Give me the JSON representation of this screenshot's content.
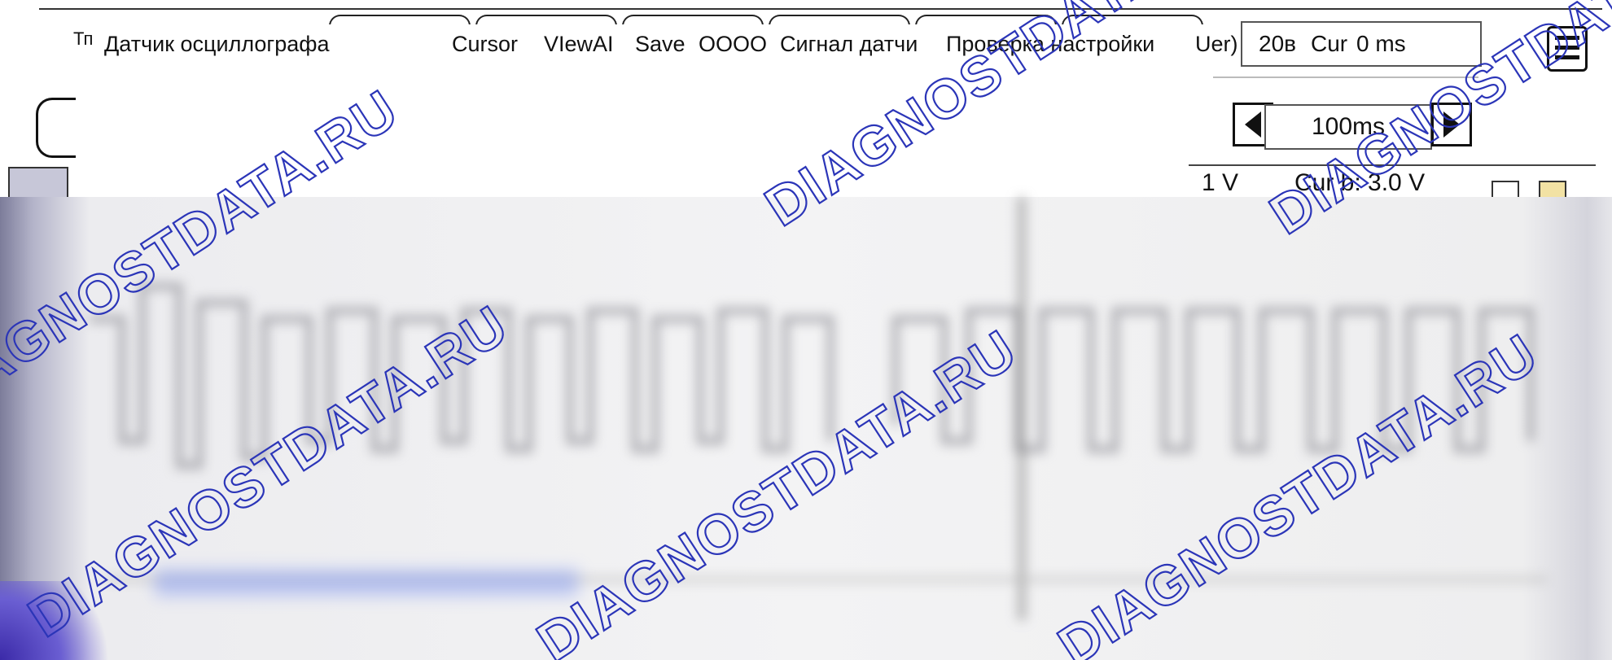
{
  "window": {
    "title_prefix": "Тп",
    "title": "Датчик осциллографа"
  },
  "menu": {
    "items": [
      "Cursor",
      "VIewAI",
      "Save",
      "OOOO",
      "Сигнал датчи",
      "Проверка настройки",
      "Uer)",
      "20в",
      "Cur"
    ]
  },
  "cursor_readout": {
    "value": "0 ms"
  },
  "timebase": {
    "value": "100ms"
  },
  "status": {
    "left": "1 V",
    "cursor_b": "Cur b: 3.0 V"
  },
  "colors": {
    "accent_red": "#d6401c",
    "blue_bar": "#8b9ff0",
    "watermark": "#2b35b8"
  },
  "icons": {
    "menu": "hamburger-icon",
    "prev": "triangle-left-icon",
    "next": "triangle-right-icon"
  },
  "watermark": {
    "text": "DIAGNOSTDATA.RU"
  }
}
